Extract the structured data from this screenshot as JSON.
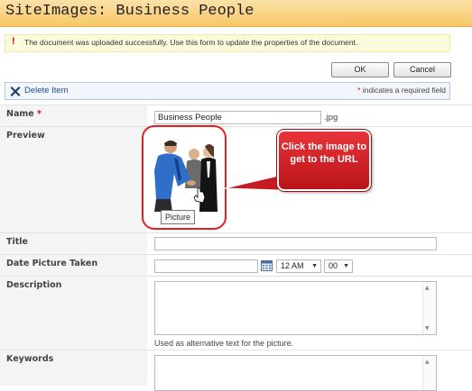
{
  "window": {
    "title": "SiteImages: Business People"
  },
  "status": {
    "icon": "exclamation-icon",
    "message": "The document was uploaded successfully. Use this form to update the properties of the document."
  },
  "buttons": {
    "ok": "OK",
    "cancel": "Cancel"
  },
  "toolbar": {
    "delete_label": "Delete Item",
    "required_star": "*",
    "required_note": " indicates a required field"
  },
  "form": {
    "name": {
      "label": "Name",
      "required_star": "*",
      "value": "Business People",
      "extension": ".jpg"
    },
    "preview": {
      "label": "Preview",
      "tooltip": "Picture"
    },
    "callout": {
      "text": "Click the image to get to the URL"
    },
    "title": {
      "label": "Title",
      "value": ""
    },
    "date_taken": {
      "label": "Date Picture Taken",
      "value": "",
      "hour": "12 AM",
      "minute": "00"
    },
    "description": {
      "label": "Description",
      "hint": "Used as alternative text for the picture."
    },
    "keywords": {
      "label": "Keywords"
    }
  },
  "colors": {
    "title_bar": "#f6c765",
    "required": "#c8102e",
    "callout": "#d3232a",
    "link": "#1a4d99"
  }
}
